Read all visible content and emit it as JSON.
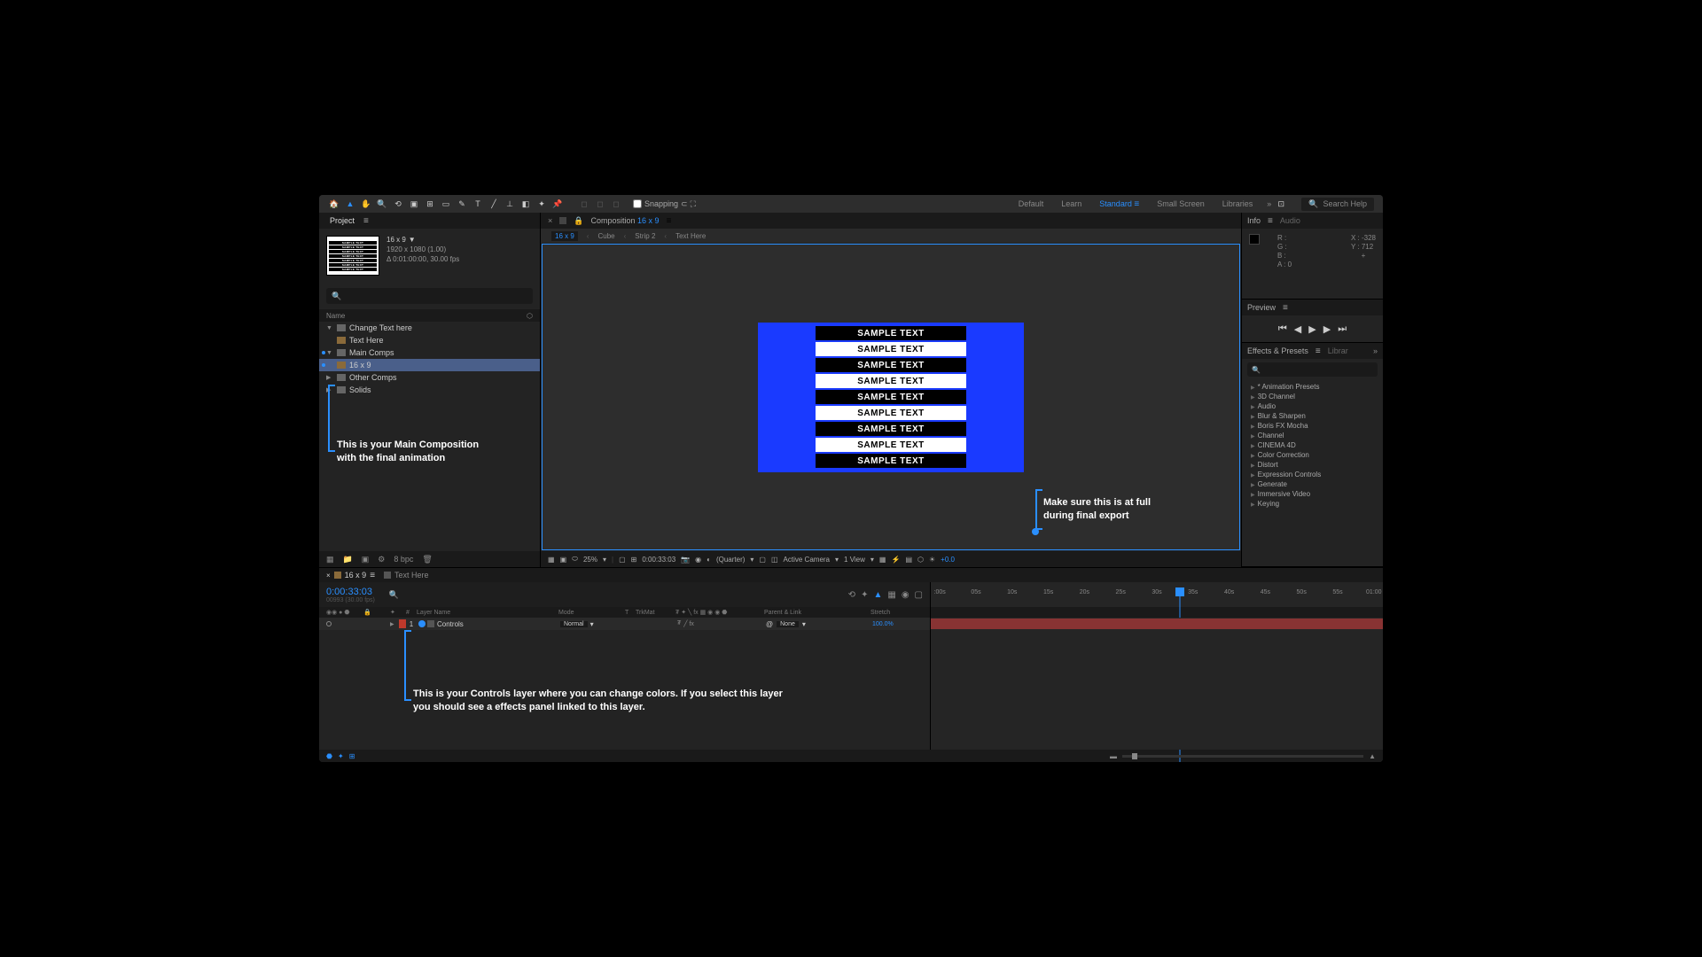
{
  "toolbar": {
    "snapping_label": "Snapping",
    "workspaces": [
      "Default",
      "Learn",
      "Standard",
      "Small Screen",
      "Libraries"
    ],
    "active_workspace": "Standard",
    "search_placeholder": "Search Help"
  },
  "project_panel": {
    "tab": "Project",
    "comp_name": "16 x 9",
    "comp_dims": "1920 x 1080 (1.00)",
    "comp_dur": "Δ 0:01:00:00, 30.00 fps",
    "header_name": "Name",
    "tree": [
      {
        "type": "folder",
        "label": "Change Text here",
        "expanded": true,
        "level": 0
      },
      {
        "type": "comp",
        "label": "Text Here",
        "level": 1
      },
      {
        "type": "folder",
        "label": "Main Comps",
        "expanded": true,
        "level": 0,
        "marked": true
      },
      {
        "type": "comp",
        "label": "16 x 9",
        "level": 1,
        "selected": true,
        "marked": true
      },
      {
        "type": "folder",
        "label": "Other Comps",
        "expanded": false,
        "level": 0
      },
      {
        "type": "folder",
        "label": "Solids",
        "expanded": false,
        "level": 0
      }
    ],
    "footer_bpc": "8 bpc"
  },
  "annotations": {
    "main_comp": "This is your Main Composition\nwith the final animation",
    "quarter": "Make sure this is at full\nduring final export",
    "controls": "This is your Controls layer where you can change colors. If you select this layer\nyou should see a effects panel linked to this layer."
  },
  "composition": {
    "panel_label": "Composition",
    "comp_link": "16 x 9",
    "breadcrumb": [
      "16 x 9",
      "Cube",
      "Strip 2",
      "Text Here"
    ],
    "sample_text": "SAMPLE TEXT"
  },
  "viewer_footer": {
    "zoom": "25%",
    "timecode": "0:00:33:03",
    "resolution": "(Quarter)",
    "camera": "Active Camera",
    "view": "1 View",
    "exposure": "+0.0"
  },
  "info_panel": {
    "tab_info": "Info",
    "tab_audio": "Audio",
    "R": "R :",
    "G": "G :",
    "B": "B :",
    "A": "A : 0",
    "X": "X : -328",
    "Y": "Y : 712"
  },
  "preview_panel": {
    "tab": "Preview"
  },
  "effects_panel": {
    "tab1": "Effects & Presets",
    "tab2": "Librar",
    "items": [
      "* Animation Presets",
      "3D Channel",
      "Audio",
      "Blur & Sharpen",
      "Boris FX Mocha",
      "Channel",
      "CINEMA 4D",
      "Color Correction",
      "Distort",
      "Expression Controls",
      "Generate",
      "Immersive Video",
      "Keying"
    ]
  },
  "timeline": {
    "tab_active": "16 x 9",
    "tab_other": "Text Here",
    "timecode": "0:00:33:03",
    "frame_sub": "00993 (30.00 fps)",
    "ticks": [
      ":00s",
      "05s",
      "10s",
      "15s",
      "20s",
      "25s",
      "30s",
      "35s",
      "40s",
      "45s",
      "50s",
      "55s",
      "01:00"
    ],
    "playhead_pct": 55,
    "cols": {
      "layer_name": "Layer Name",
      "mode": "Mode",
      "trkmat": "TrkMat",
      "parent": "Parent & Link",
      "stretch": "Stretch",
      "t": "T"
    },
    "layer": {
      "num": "1",
      "name": "Controls",
      "mode": "Normal",
      "parent": "None",
      "stretch": "100.0%"
    }
  }
}
